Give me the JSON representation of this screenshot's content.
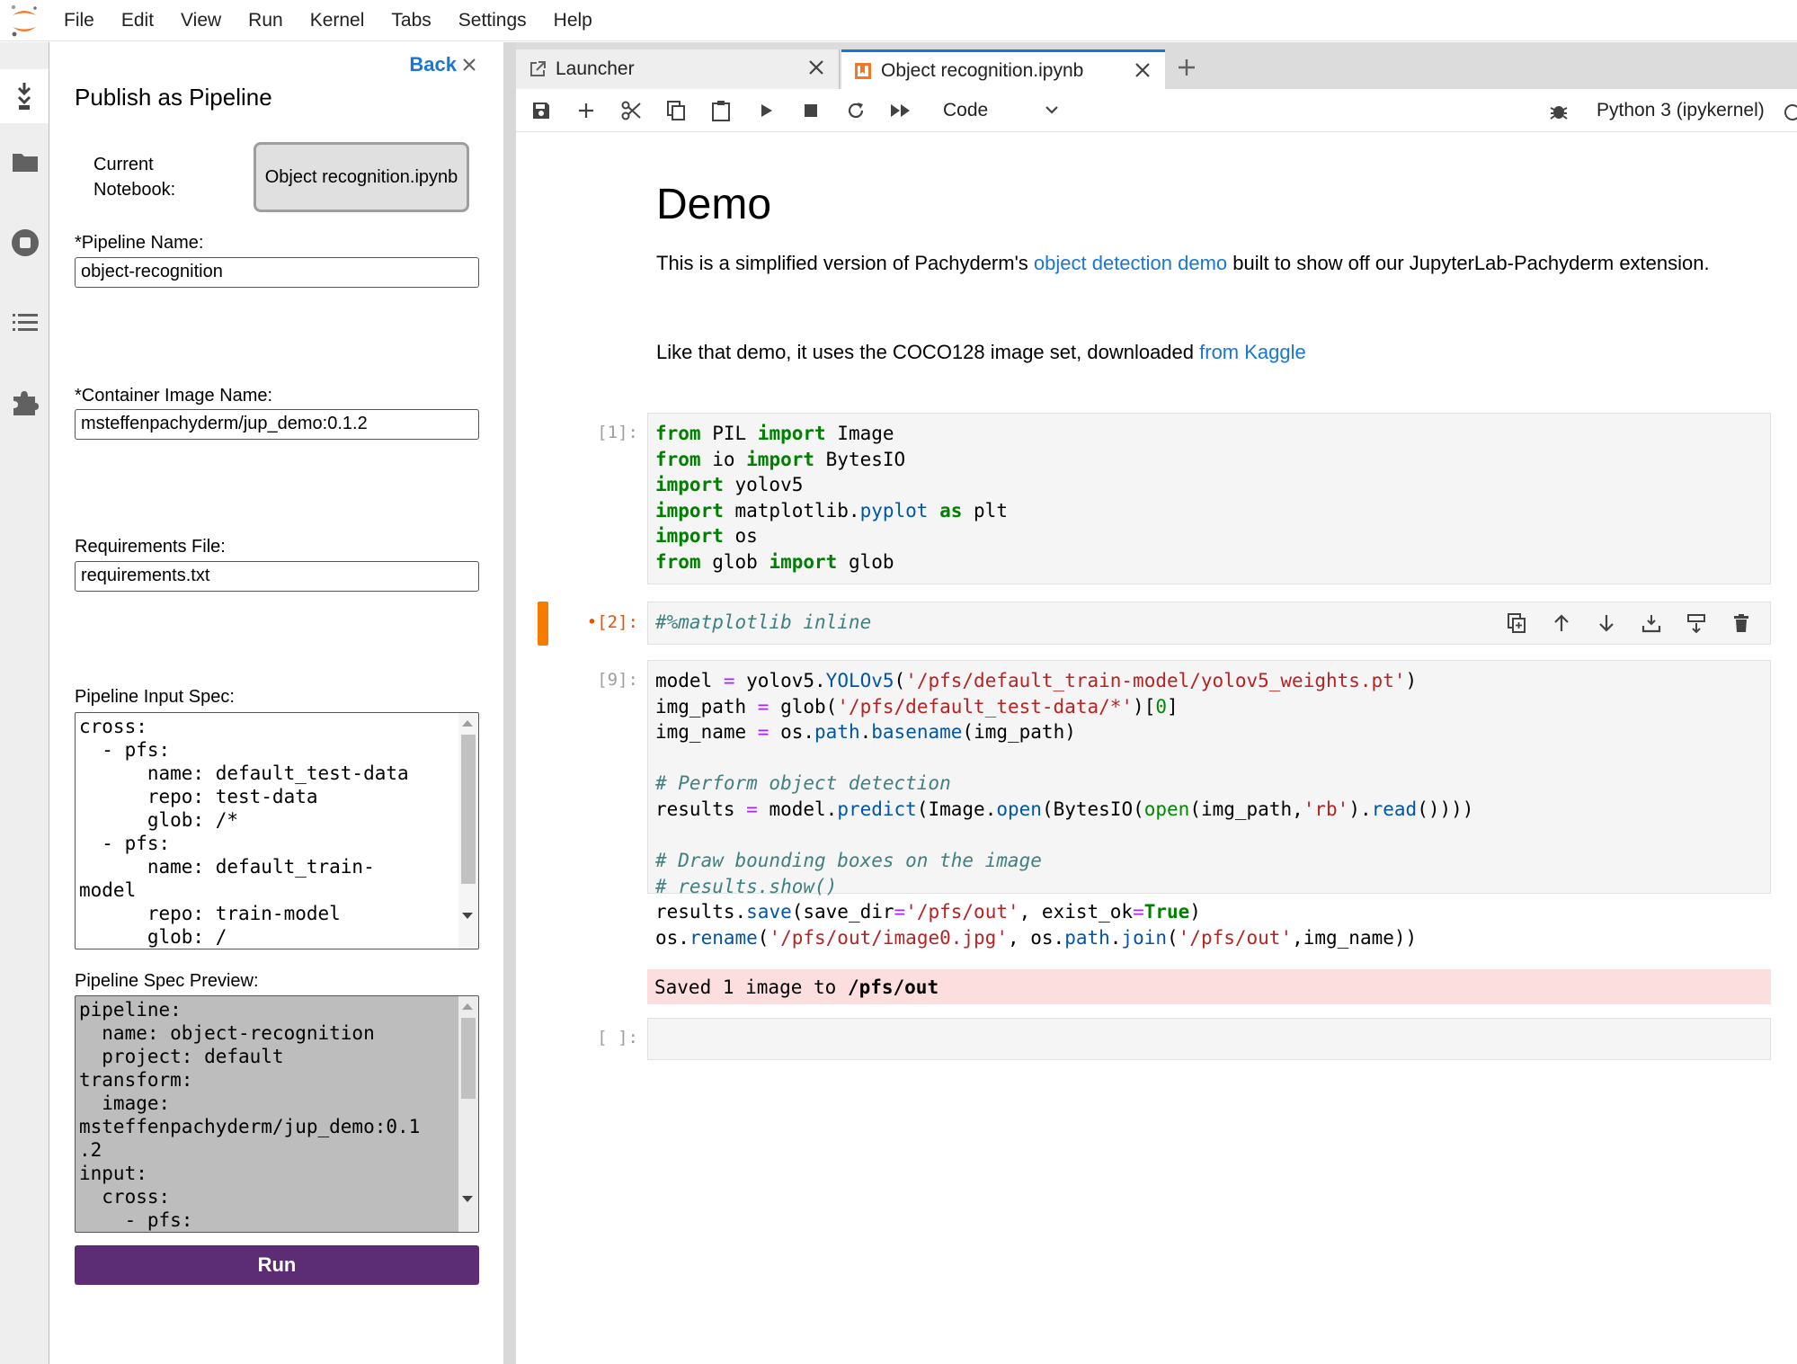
{
  "menu": {
    "items": [
      "File",
      "Edit",
      "View",
      "Run",
      "Kernel",
      "Tabs",
      "Settings",
      "Help"
    ]
  },
  "side_panel": {
    "back_label": "Back",
    "title": "Publish as Pipeline",
    "current_notebook_label": "Current Notebook:",
    "current_notebook_value": "Object recognition.ipynb",
    "pipeline_name_label": "*Pipeline Name:",
    "pipeline_name_value": "object-recognition",
    "container_image_label": "*Container Image Name:",
    "container_image_value": "msteffenpachyderm/jup_demo:0.1.2",
    "requirements_label": "Requirements File:",
    "requirements_value": "requirements.txt",
    "input_spec_label": "Pipeline Input Spec:",
    "input_spec_text": "cross:\n  - pfs:\n      name: default_test-data\n      repo: test-data\n      glob: /*\n  - pfs:\n      name: default_train-\nmodel\n      repo: train-model\n      glob: /",
    "spec_preview_label": "Pipeline Spec Preview:",
    "spec_preview_text": "pipeline:\n  name: object-recognition\n  project: default\ntransform:\n  image:\nmsteffenpachyderm/jup_demo:0.1\n.2\ninput:\n  cross:\n    - pfs:",
    "run_label": "Run"
  },
  "tabs": [
    {
      "label": "Launcher",
      "icon": "external-link-icon"
    },
    {
      "label": "Object recognition.ipynb",
      "icon": "notebook-icon"
    }
  ],
  "toolbar": {
    "cell_type": "Code",
    "kernel_name": "Python 3 (ipykernel)"
  },
  "notebook": {
    "heading": "Demo",
    "par1_a": "This is a simplified version of Pachyderm's ",
    "par1_link": "object detection demo",
    "par1_b": " built to show off our JupyterLab-Pachyderm extension.",
    "par2_a": "Like that demo, it uses the COCO128 image set, downloaded ",
    "par2_link": "from Kaggle",
    "cells": [
      {
        "prompt": "[1]:"
      },
      {
        "prompt": "•[2]:"
      },
      {
        "prompt": "[9]:",
        "output": "Saved 1 image to "
      },
      {
        "prompt": "[ ]:"
      }
    ],
    "output_bold": "/pfs/out"
  },
  "colors": {
    "accent": "#1976d2",
    "run_button": "#5c2d75",
    "active_cell": "#f57c00",
    "output_bg": "#fddede"
  }
}
